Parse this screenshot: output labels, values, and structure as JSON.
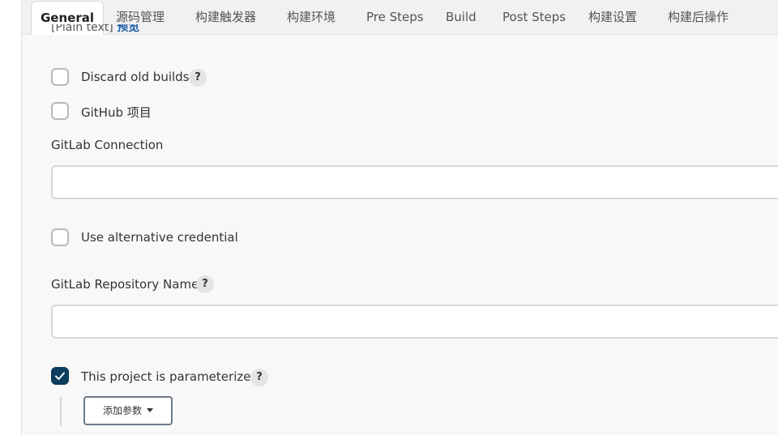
{
  "tabs": [
    {
      "label": "General",
      "active": true
    },
    {
      "label": "源码管理"
    },
    {
      "label": "构建触发器"
    },
    {
      "label": "构建环境"
    },
    {
      "label": "Pre Steps"
    },
    {
      "label": "Build"
    },
    {
      "label": "Post Steps"
    },
    {
      "label": "构建设置"
    },
    {
      "label": "构建后操作"
    }
  ],
  "top_cut": {
    "plain": "[Plain text]",
    "preview": "预览"
  },
  "options": {
    "discard_old_builds": {
      "label": "Discard old builds",
      "checked": false
    },
    "github_project": {
      "label": "GitHub 项目",
      "checked": false
    },
    "use_alt_credential": {
      "label": "Use alternative credential",
      "checked": false
    },
    "parameterized": {
      "label": "This project is parameterized",
      "checked": true
    }
  },
  "fields": {
    "gitlab_connection": {
      "label": "GitLab Connection",
      "value": ""
    },
    "gitlab_repo_name": {
      "label": "GitLab Repository Name",
      "value": ""
    }
  },
  "help_glyph": "?",
  "add_param_button": {
    "label": "添加参数"
  },
  "colors": {
    "checked": "#0b3d5c",
    "link": "#1a5ea8"
  }
}
